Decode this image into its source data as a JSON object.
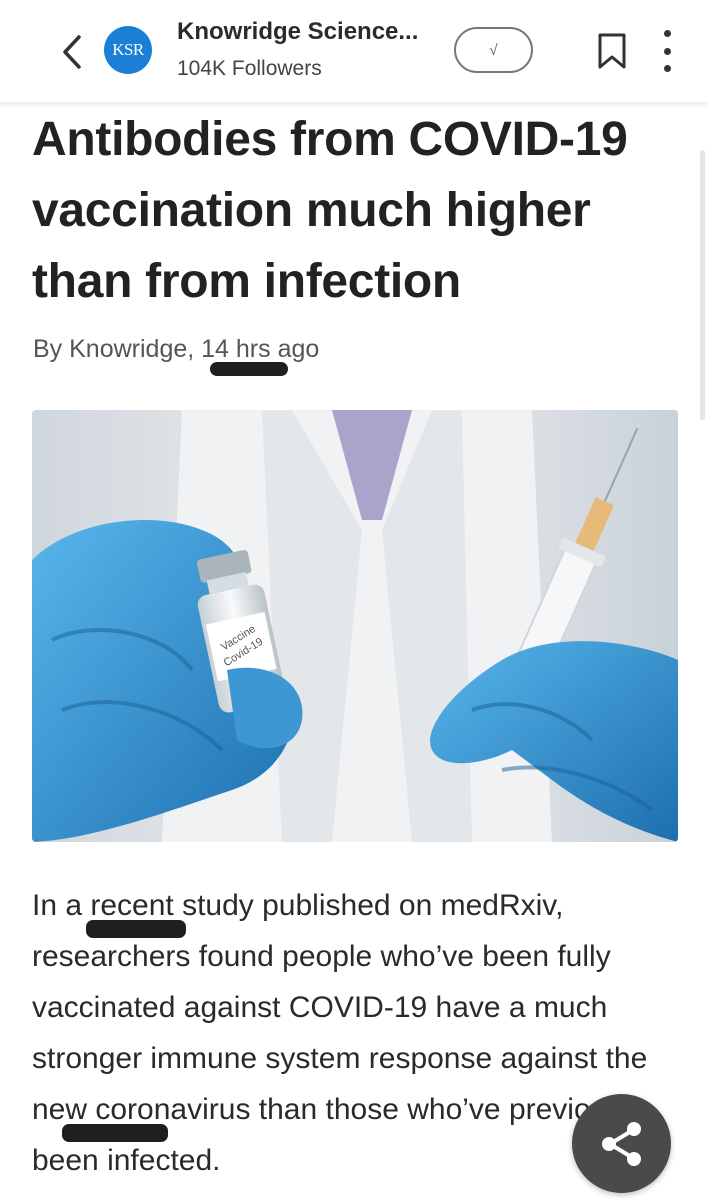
{
  "header": {
    "publisher_logo_text": "KSR",
    "publisher_name": "Knowridge Science...",
    "followers": "104K Followers",
    "follow_label": "√",
    "icons": {
      "back": "chevron-left-icon",
      "bookmark": "bookmark-icon",
      "more": "more-vertical-icon"
    }
  },
  "article": {
    "title": "Antibodies from COVID-19 vaccination much higher than from infection",
    "byline": "By Knowridge, 14 hrs ago",
    "image": {
      "vial_label_line1": "Vaccine",
      "vial_label_line2": "Covid-19"
    },
    "body": "In a recent study published on medRxiv, researchers found people who’ve been fully vaccinated against COVID-19 have a much stronger immune system response against the new coronavirus than those who’ve previously been infected."
  },
  "actions": {
    "share_icon": "share-icon"
  },
  "colors": {
    "accent_blue": "#1b7fd6",
    "glove_blue": "#3a9fd9",
    "fab": "#4a4a4a"
  }
}
